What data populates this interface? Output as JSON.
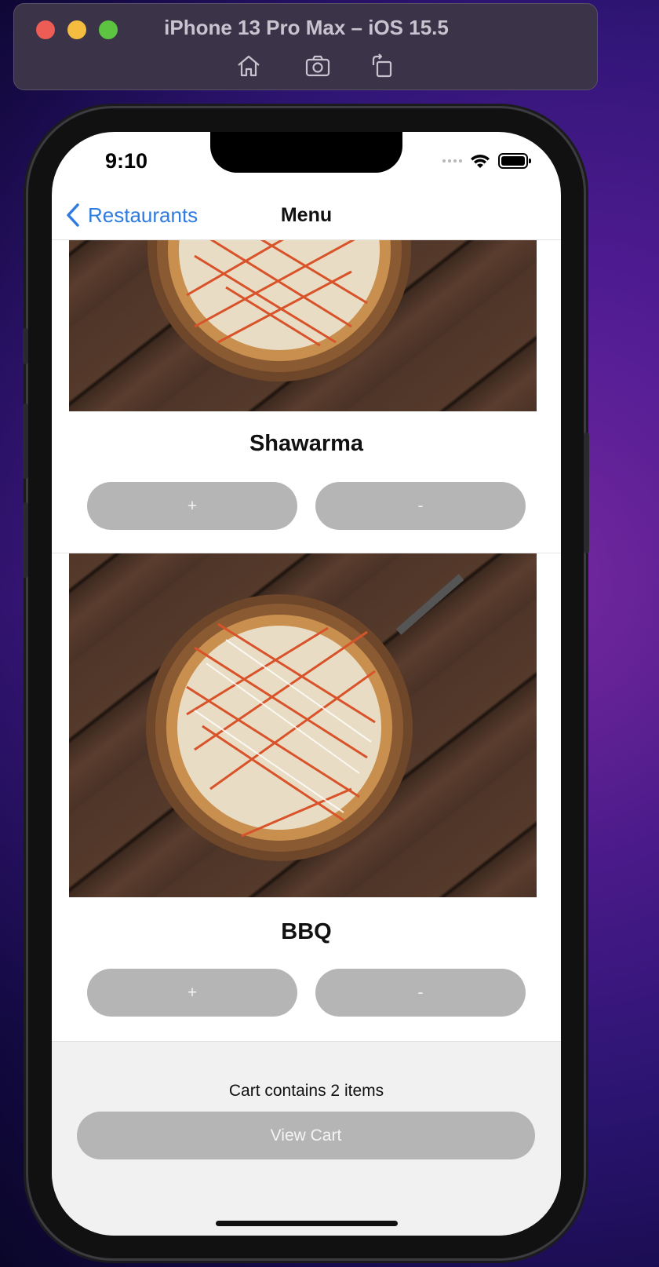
{
  "simulator": {
    "title": "iPhone 13 Pro Max – iOS 15.5",
    "tools": [
      "home-icon",
      "screenshot-icon",
      "rotate-icon"
    ]
  },
  "status_bar": {
    "time": "9:10"
  },
  "nav": {
    "back_label": "Restaurants",
    "title": "Menu"
  },
  "menu_items": [
    {
      "name": "Shawarma",
      "add_label": "+",
      "remove_label": "-"
    },
    {
      "name": "BBQ",
      "add_label": "+",
      "remove_label": "-"
    }
  ],
  "cart": {
    "summary": "Cart contains 2 items",
    "button_label": "View Cart"
  },
  "colors": {
    "accent": "#2f7bdf",
    "button_gray": "#b5b5b5",
    "cart_background": "#f1f1f1"
  }
}
